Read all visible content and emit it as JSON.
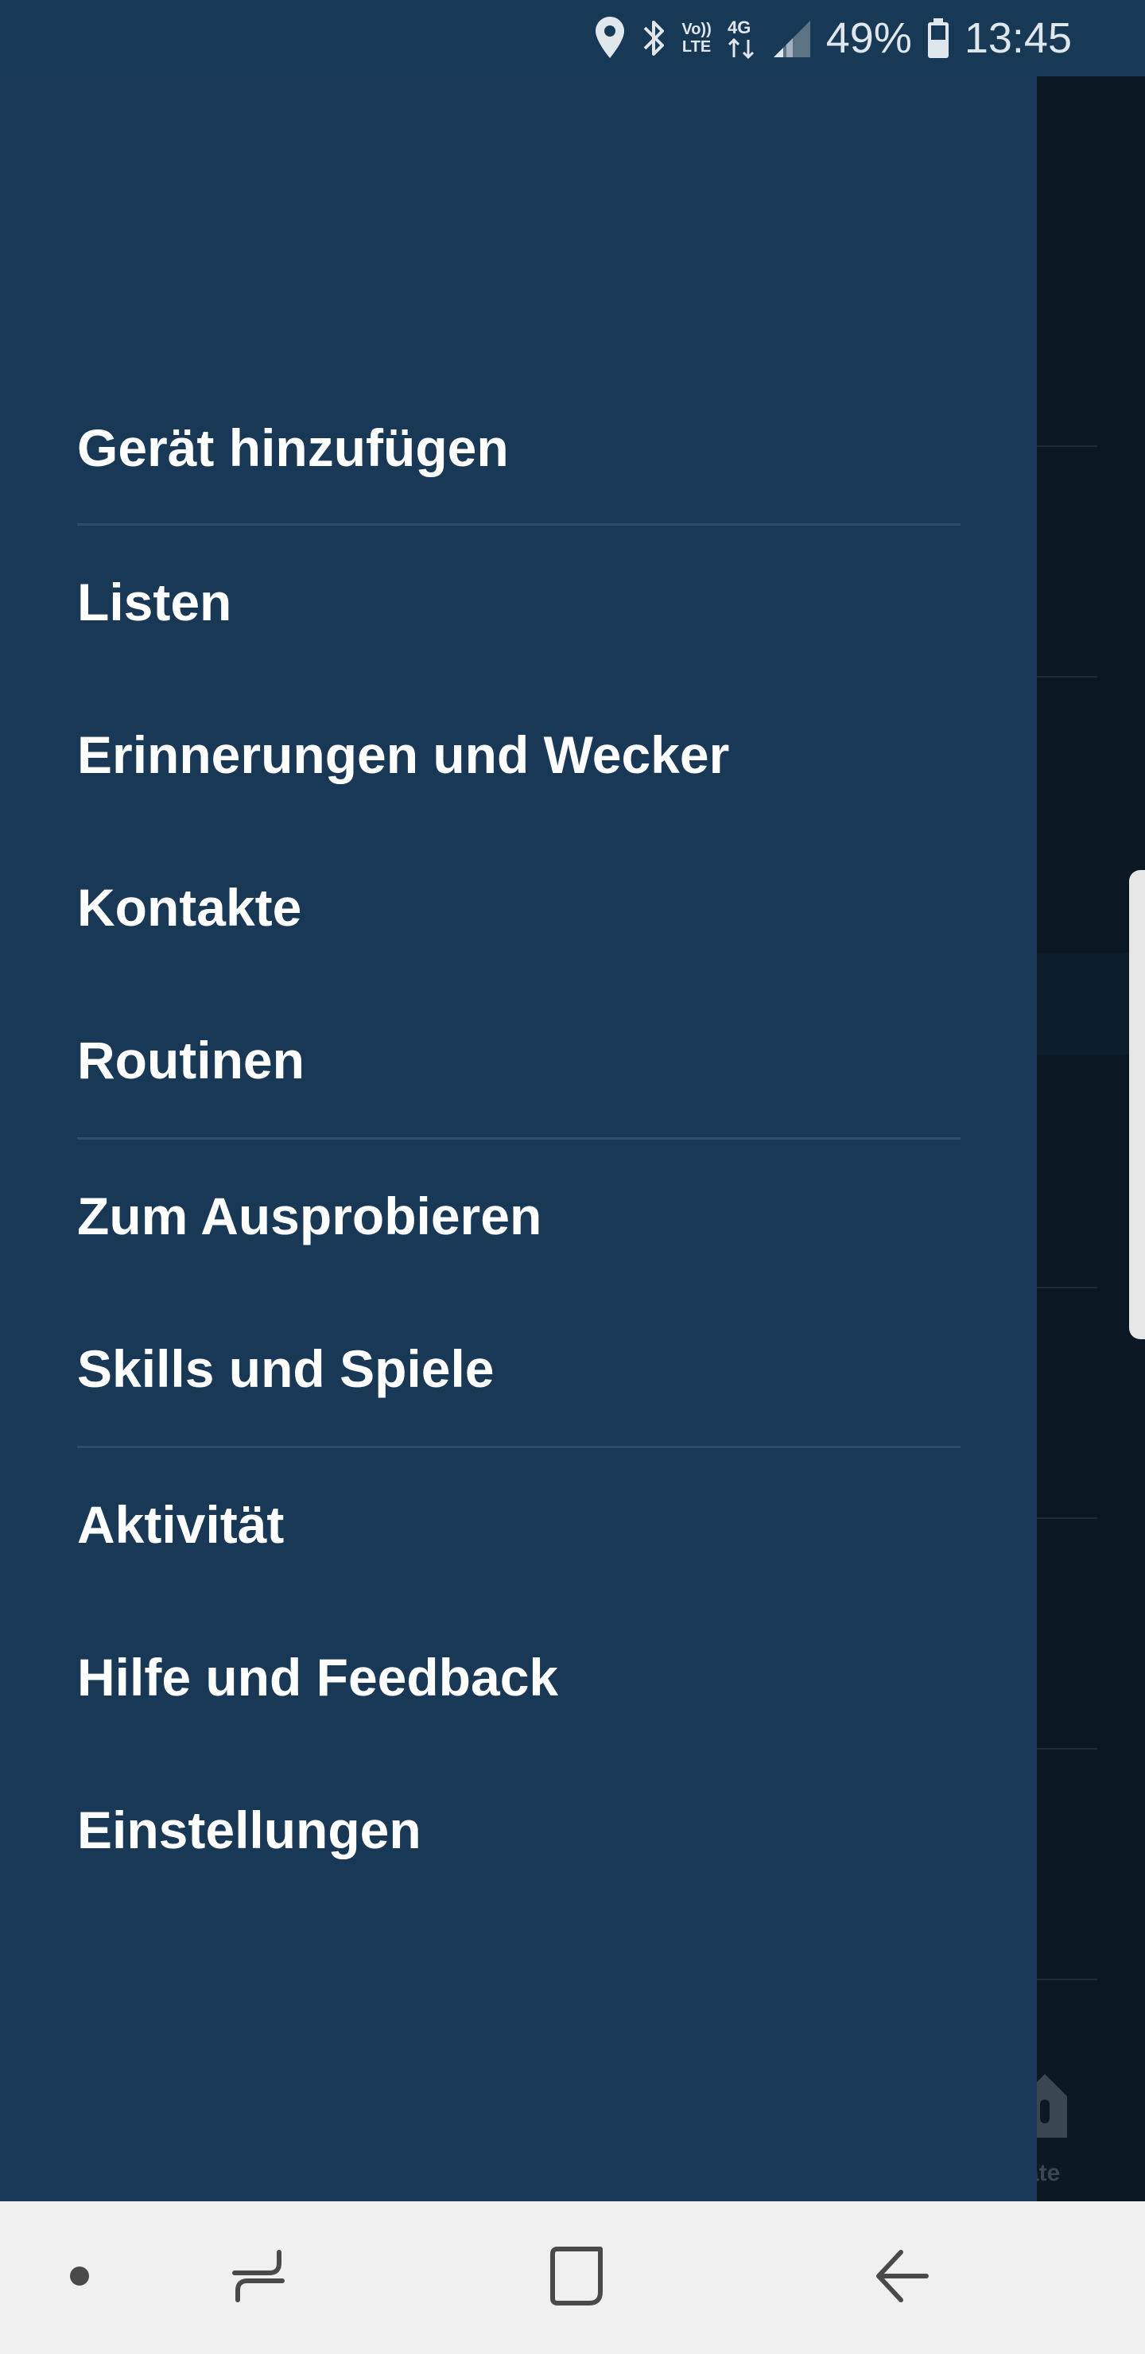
{
  "status_bar": {
    "battery_percent": "49%",
    "time": "13:45",
    "network": "4G",
    "volte": "Vo))\nLTE",
    "icons": [
      "location-icon",
      "bluetooth-icon",
      "volte-icon",
      "4g-data-icon",
      "signal-icon",
      "battery-icon"
    ]
  },
  "drawer": {
    "items": [
      {
        "label": "Gerät hinzufügen"
      },
      {
        "label": "Listen"
      },
      {
        "label": "Erinnerungen und Wecker"
      },
      {
        "label": "Kontakte"
      },
      {
        "label": "Routinen"
      },
      {
        "label": "Zum Ausprobieren"
      },
      {
        "label": "Skills und Spiele"
      },
      {
        "label": "Aktivität"
      },
      {
        "label": "Hilfe und Feedback"
      },
      {
        "label": "Einstellungen"
      }
    ]
  },
  "background_app": {
    "bottom_nav_label": "äte"
  },
  "navbar": {
    "icons": [
      "dot-icon",
      "recent-apps-icon",
      "home-icon",
      "back-icon"
    ]
  },
  "colors": {
    "drawer_bg": "#183855",
    "status_bar_bg": "#183955",
    "nav_bar_bg": "#f0f0f0",
    "text": "#ffffff"
  }
}
